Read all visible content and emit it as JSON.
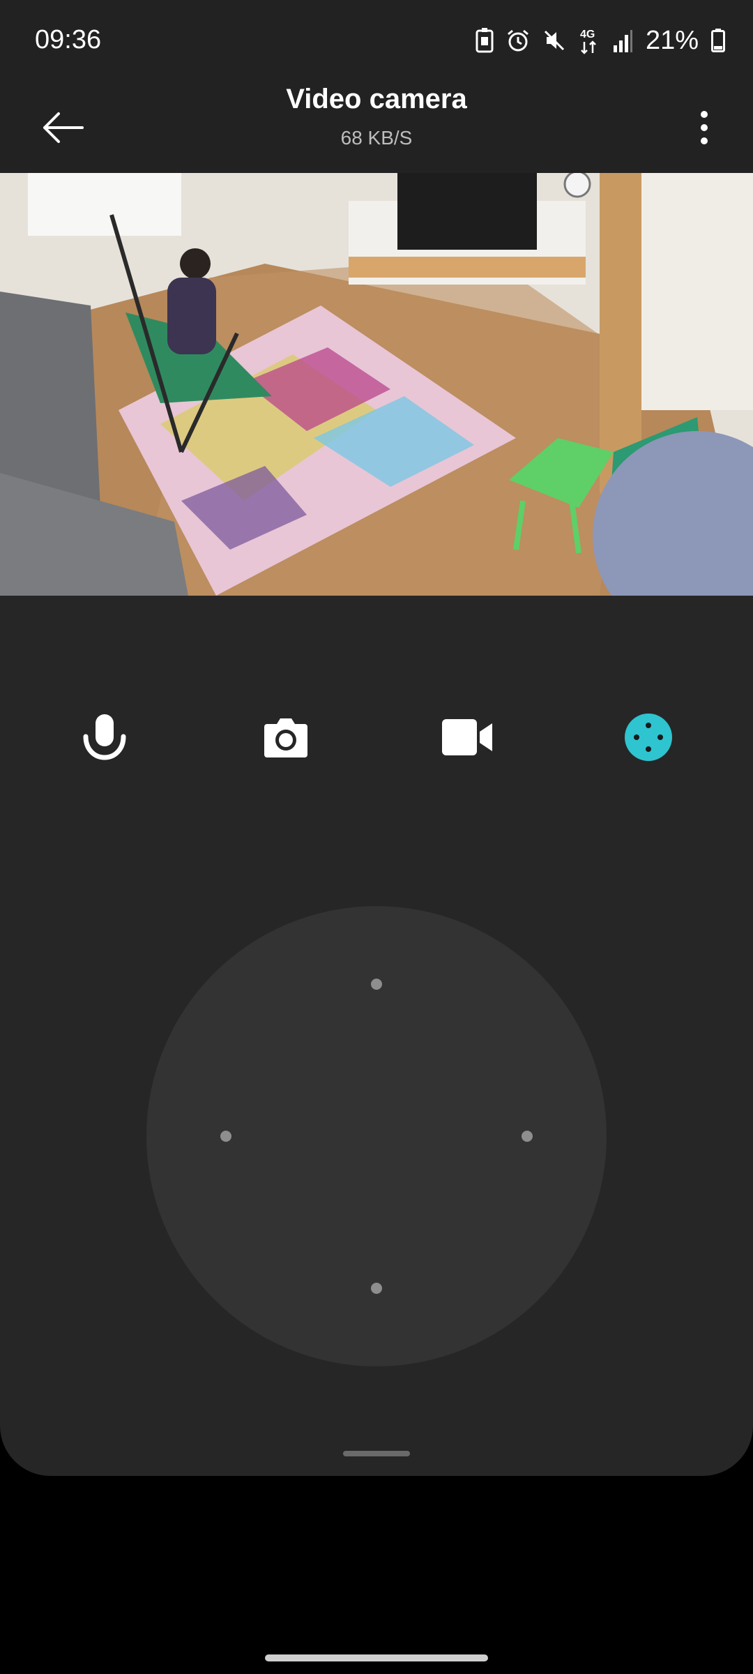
{
  "status_bar": {
    "time": "09:36",
    "battery": "21%",
    "icons": [
      "nfc-icon",
      "alarm-icon",
      "mute-icon",
      "4g-icon",
      "signal-icon",
      "battery-icon"
    ],
    "network": "4G"
  },
  "app_bar": {
    "title": "Video camera",
    "subtitle": "68 KB/S",
    "back_icon": "arrow-left-icon",
    "menu_icon": "more-vertical-icon"
  },
  "video_feed": {
    "description_icon": "live-camera-view"
  },
  "controls": {
    "items": [
      {
        "name": "microphone",
        "icon": "microphone-icon"
      },
      {
        "name": "snapshot",
        "icon": "camera-icon"
      },
      {
        "name": "record",
        "icon": "video-camera-icon"
      },
      {
        "name": "ptz",
        "icon": "ptz-control-icon",
        "active": true
      }
    ],
    "accent_color": "#2ec4d0"
  },
  "joystick": {
    "directions": [
      "up",
      "left",
      "right",
      "down"
    ]
  }
}
